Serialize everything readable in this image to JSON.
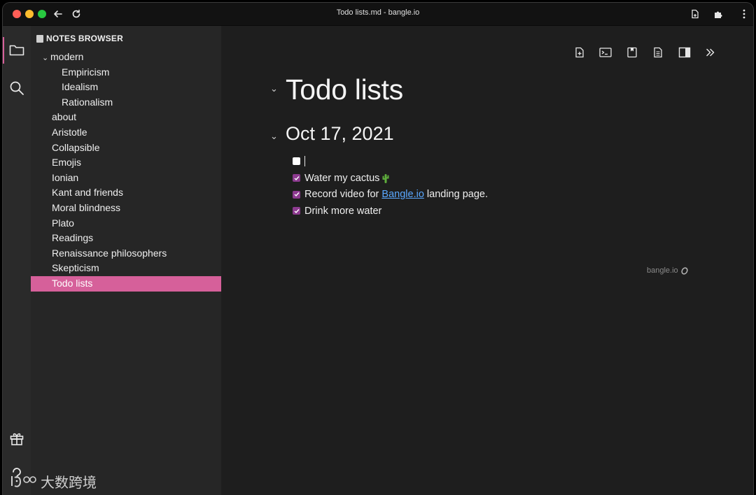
{
  "window": {
    "title": "Todo lists.md - bangle.io"
  },
  "titlebar_icons": [
    "back-arrow-icon",
    "reload-icon",
    "document-icon",
    "puzzle-icon",
    "kebab-menu-icon"
  ],
  "activitybar": {
    "items": [
      "folder-icon",
      "search-icon"
    ],
    "bottom": [
      "gift-icon",
      "help-icon"
    ]
  },
  "sidebar": {
    "header": "NOTES BROWSER",
    "folder": {
      "label": "modern",
      "children": [
        "Empiricism",
        "Idealism",
        "Rationalism"
      ]
    },
    "notes": [
      "about",
      "Aristotle",
      "Collapsible",
      "Emojis",
      "Ionian",
      "Kant and friends",
      "Moral blindness",
      "Plato",
      "Readings",
      "Renaissance philosophers",
      "Skepticism",
      "Todo lists"
    ],
    "active_note": "Todo lists"
  },
  "toolbar": [
    "new-note-icon",
    "terminal-icon",
    "bookmark-icon",
    "page-icon",
    "split-panel-icon",
    "double-chevron-icon"
  ],
  "document": {
    "h1": "Todo lists",
    "h2": "Oct 17, 2021",
    "todos": [
      {
        "checked": false,
        "text": ""
      },
      {
        "checked": true,
        "text": "Water my cactus"
      },
      {
        "checked": true,
        "text_before": "Record video for ",
        "link": "Bangle.io",
        "text_after": " landing page."
      },
      {
        "checked": true,
        "text": "Drink more water"
      }
    ]
  },
  "brand_mark": "bangle.io",
  "corner_watermark": "大数跨境",
  "colors": {
    "accent": "#d6609a",
    "checkbox": "#8c3a8f",
    "link": "#5aa8ff"
  }
}
